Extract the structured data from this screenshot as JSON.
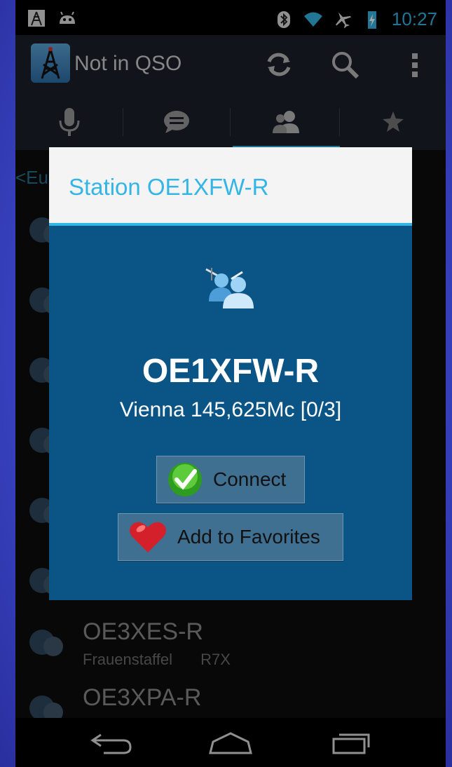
{
  "status_bar": {
    "time": "10:27",
    "left_icons": [
      "cell-tower-icon",
      "android-icon"
    ],
    "right_icons": [
      "bluetooth-icon",
      "wifi-icon",
      "airplane-mode-icon",
      "battery-charging-icon"
    ]
  },
  "action_bar": {
    "title": "Not in QSO",
    "actions": [
      "refresh-icon",
      "search-icon",
      "overflow-menu-icon"
    ]
  },
  "tabs": [
    {
      "icon": "microphone-icon",
      "selected": false
    },
    {
      "icon": "chat-icon",
      "selected": false
    },
    {
      "icon": "users-icon",
      "selected": true
    },
    {
      "icon": "star-icon",
      "selected": false
    }
  ],
  "background_list": {
    "breadcrumb": "<Eu",
    "visible_rows": [
      {
        "title": "OE3XES-R",
        "location": "Frauenstaffel",
        "info": "R7X"
      },
      {
        "title": "OE3XPA-R",
        "location": "",
        "info": ""
      }
    ]
  },
  "dialog": {
    "title": "Station OE1XFW-R",
    "callsign": "OE1XFW-R",
    "info": "Vienna 145,625Mc [0/3]",
    "connect_label": "Connect",
    "favorites_label": "Add to Favorites"
  },
  "nav_bar": {
    "buttons": [
      "back-icon",
      "home-icon",
      "recent-apps-icon"
    ]
  },
  "colors": {
    "accent": "#33b5e5",
    "dialog_body": "#0a5586",
    "dialog_header": "#f4f4f4",
    "button_bg": "#3f6f91"
  }
}
